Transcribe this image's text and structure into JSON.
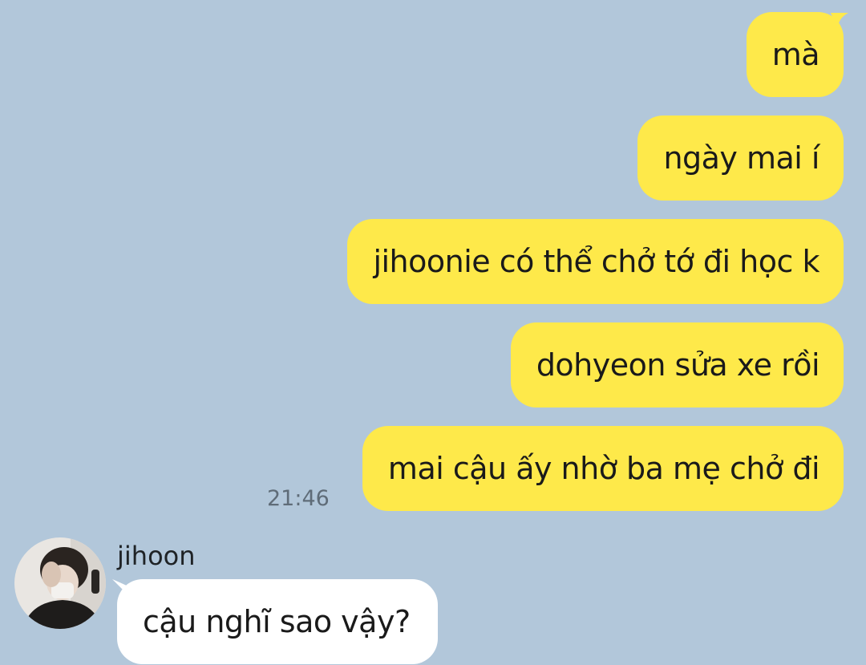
{
  "colors": {
    "background": "#b2c7da",
    "outgoing_bubble": "#fee94a",
    "incoming_bubble": "#ffffff",
    "timestamp": "#5f6c78"
  },
  "outgoing_messages": [
    {
      "text": "mà"
    },
    {
      "text": "ngày mai í"
    },
    {
      "text": "jihoonie có thể chở tớ đi học k"
    },
    {
      "text": "dohyeon sửa xe rồi"
    },
    {
      "text": "mai cậu ấy nhờ ba mẹ chở đi"
    }
  ],
  "outgoing_timestamp": "21:46",
  "incoming": {
    "sender_name": "jihoon",
    "avatar_icon": "profile-photo",
    "messages": [
      {
        "text": "cậu nghĩ sao vậy?"
      }
    ]
  }
}
